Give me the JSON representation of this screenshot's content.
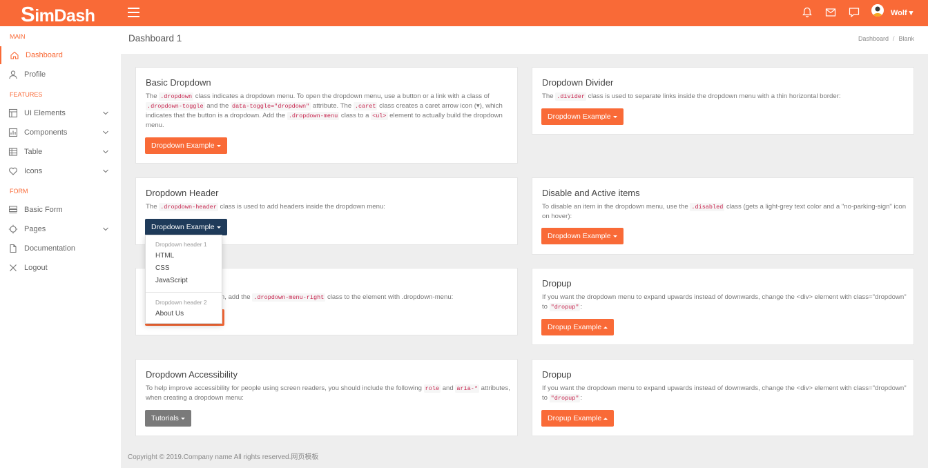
{
  "brand": {
    "logo_first": "S",
    "logo_rest": "imDash"
  },
  "topbar": {
    "user_name": "Wolf"
  },
  "colors": {
    "accent": "#f96a37",
    "dark_button": "#1f3b5a",
    "grey_button": "#7a7a7a"
  },
  "sidebar": {
    "sections": [
      "MAIN",
      "FEATURES",
      "FORM"
    ],
    "items": [
      {
        "label": "Dashboard",
        "icon": "home-icon"
      },
      {
        "label": "Profile",
        "icon": "user-icon"
      },
      {
        "label": "UI Elements",
        "icon": "layout-icon"
      },
      {
        "label": "Components",
        "icon": "chart-icon"
      },
      {
        "label": "Table",
        "icon": "table-icon"
      },
      {
        "label": "Icons",
        "icon": "heart-icon"
      },
      {
        "label": "Basic Form",
        "icon": "form-icon"
      },
      {
        "label": "Pages",
        "icon": "crosshair-icon"
      },
      {
        "label": "Documentation",
        "icon": "file-icon"
      },
      {
        "label": "Logout",
        "icon": "close-icon"
      }
    ]
  },
  "header": {
    "title": "Dashboard 1",
    "breadcrumb": [
      "Dashboard",
      "Blank"
    ]
  },
  "cards": {
    "basic": {
      "title": "Basic Dropdown",
      "t1": "The ",
      "c1": ".dropdown",
      "t2": " class indicates a dropdown menu. To open the dropdown menu, use a button or a link with a class of ",
      "c2": ".dropdown-toggle",
      "t3": " and the ",
      "c3": "data-toggle=\"dropdown\"",
      "t4": " attribute. The ",
      "c4": ".caret",
      "t5": " class creates a caret arrow icon (▾), which indicates that the button is a dropdown. Add the ",
      "c5": ".dropdown-menu",
      "t6": " class to a ",
      "c6": "<ul>",
      "t7": " element to actually build the dropdown menu.",
      "button": "Dropdown Example"
    },
    "divider": {
      "title": "Dropdown Divider",
      "t1": "The ",
      "c1": ".divider",
      "t2": " class is used to separate links inside the dropdown menu with a thin horizontal border:",
      "button": "Dropdown Example"
    },
    "header_card": {
      "title": "Dropdown Header",
      "t1": "The ",
      "c1": ".dropdown-header",
      "t2": " class is used to add headers inside the dropdown menu:",
      "button": "Dropdown Example"
    },
    "disable": {
      "title": "Disable and Active items",
      "t1": "To disable an item in the dropdown menu, use the ",
      "c1": ".disabled",
      "t2": " class (gets a light-grey text color and a \"no-parking-sign\" icon on hover):",
      "button": "Dropdown Example"
    },
    "right": {
      "t1": "wn, add the ",
      "c1": ".dropdown-menu-right",
      "t2": " class to the element with .dropdown-menu:"
    },
    "dropup1": {
      "title": "Dropup",
      "t1": "If you want the dropdown menu to expand upwards instead of downwards, change the <div> element with class=\"dropdown\" to ",
      "c1": "\"dropup\"",
      "t2": ":",
      "button": "Dropup Example"
    },
    "access": {
      "title": "Dropdown Accessibility",
      "t1": "To help improve accessibility for people using screen readers, you should include the following ",
      "c1": "role",
      "t2": " and ",
      "c2": "aria-*",
      "t3": " attributes, when creating a dropdown menu:",
      "button": "Tutorials"
    },
    "dropup2": {
      "title": "Dropup",
      "t1": "If you want the dropdown menu to expand upwards instead of downwards, change the <div> element with class=\"dropdown\" to ",
      "c1": "\"dropup\"",
      "t2": ":",
      "button": "Dropup Example"
    }
  },
  "dropdown_menu": {
    "header1": "Dropdown header 1",
    "items1": [
      "HTML",
      "CSS",
      "JavaScript"
    ],
    "header2": "Dropdown header 2",
    "items2": [
      "About Us"
    ]
  },
  "footer": "Copyright © 2019.Company name All rights reserved.网页模板"
}
